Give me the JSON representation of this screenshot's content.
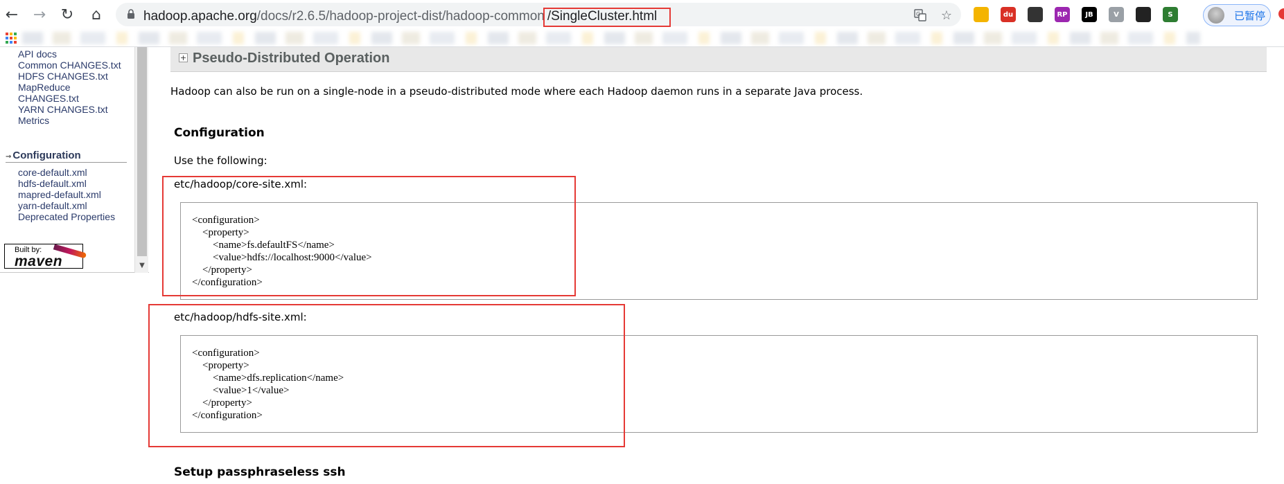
{
  "browser": {
    "url_host": "hadoop.apache.org",
    "url_path": "/docs/r2.6.5/hadoop-project-dist/hadoop-common",
    "url_highlight": "/SingleCluster.html",
    "nav": {
      "back": "back-arrow-icon",
      "forward": "forward-arrow-icon",
      "reload": "reload-icon",
      "home": "home-icon"
    },
    "omnibox_icons": [
      "translate-icon",
      "bookmark-star-icon"
    ],
    "profile_label": "已暂停",
    "extensions": [
      {
        "name": "colorful-pinwheel-extension-icon",
        "label": "",
        "color": "#f4b400"
      },
      {
        "name": "baidu-extension-icon",
        "label": "du",
        "color": "#d93025"
      },
      {
        "name": "spy-extension-icon",
        "label": "",
        "color": "#333333"
      },
      {
        "name": "jetbrains-rp-extension-icon",
        "label": "RP",
        "color": "#9c27b0"
      },
      {
        "name": "jetbrains-jb-extension-icon",
        "label": "JB",
        "color": "#000000"
      },
      {
        "name": "vue-devtools-extension-icon",
        "label": "V",
        "color": "#9aa0a6"
      },
      {
        "name": "tampermonkey-extension-icon",
        "label": "",
        "color": "#222222"
      },
      {
        "name": "s-extension-icon",
        "label": "S",
        "color": "#2e7d32"
      }
    ]
  },
  "sidebar": {
    "links": [
      "API docs",
      "Common CHANGES.txt",
      "HDFS CHANGES.txt",
      "MapReduce",
      "CHANGES.txt",
      "YARN CHANGES.txt",
      "Metrics"
    ],
    "config_heading": "Configuration",
    "config_links": [
      "core-default.xml",
      "hdfs-default.xml",
      "mapred-default.xml",
      "yarn-default.xml",
      "Deprecated Properties"
    ],
    "badge_built_by": "Built by:",
    "badge_name": "maven"
  },
  "content": {
    "section_title": "Pseudo-Distributed Operation",
    "intro": "Hadoop can also be run on a single-node in a pseudo-distributed mode where each Hadoop daemon runs in a separate Java process.",
    "config_heading": "Configuration",
    "use_following": "Use the following:",
    "core_site_label": "etc/hadoop/core-site.xml:",
    "core_site_code": "<configuration>\n    <property>\n        <name>fs.defaultFS</name>\n        <value>hdfs://localhost:9000</value>\n    </property>\n</configuration>",
    "hdfs_site_label": "etc/hadoop/hdfs-site.xml:",
    "hdfs_site_code": "<configuration>\n    <property>\n        <name>dfs.replication</name>\n        <value>1</value>\n    </property>\n</configuration>",
    "ssh_heading": "Setup passphraseless ssh"
  },
  "colors": {
    "annotation_red": "#e53935",
    "nav_link": "#2a3a6a",
    "section_bar": "#e8e8e8"
  }
}
